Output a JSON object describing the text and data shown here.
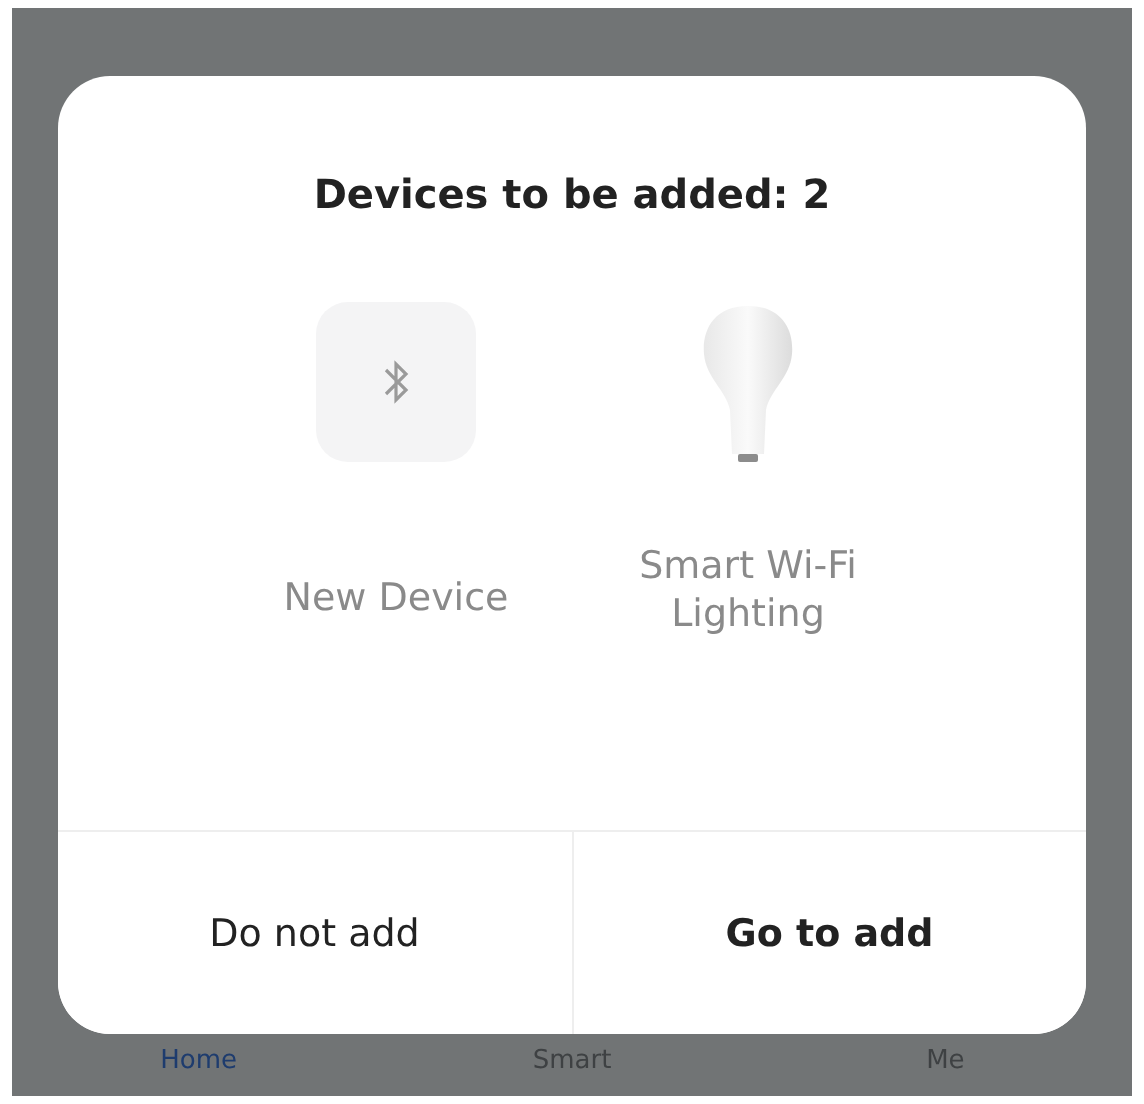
{
  "dialog": {
    "title": "Devices to be added: 2",
    "devices": [
      {
        "kind": "bluetooth",
        "name": "New Device"
      },
      {
        "kind": "bulb",
        "name": "Smart Wi-Fi Lighting"
      }
    ],
    "buttons": [
      {
        "kind": "secondary",
        "label": "Do not add"
      },
      {
        "kind": "primary",
        "label": "Go to add"
      }
    ]
  },
  "tab_bar": [
    {
      "label": "Home",
      "selected": true
    },
    {
      "label": "Smart",
      "selected": false
    },
    {
      "label": "Me",
      "selected": false
    }
  ]
}
